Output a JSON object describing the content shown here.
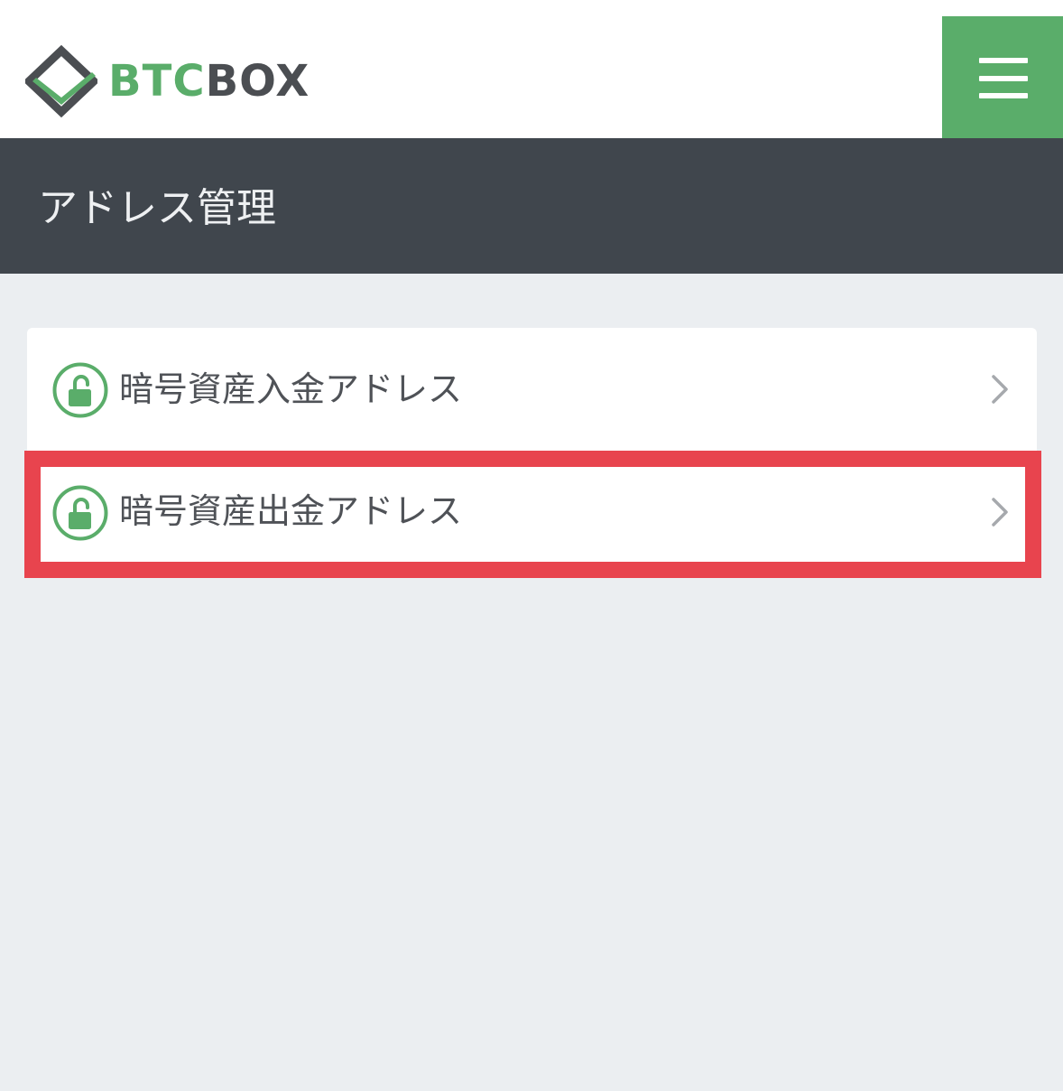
{
  "header": {
    "logo_text_btc": "BTC",
    "logo_text_box": "BOX",
    "logo_icon": "diamond-check-logo",
    "menu_icon": "hamburger-menu-icon"
  },
  "page": {
    "title": "アドレス管理"
  },
  "address_menu": {
    "items": [
      {
        "label": "暗号資産入金アドレス",
        "icon": "unlock-icon",
        "chevron": "chevron-right-icon"
      },
      {
        "label": "暗号資産出金アドレス",
        "icon": "unlock-icon",
        "chevron": "chevron-right-icon",
        "highlighted": true
      }
    ]
  },
  "colors": {
    "brand_green": "#5aad6a",
    "dark_gray": "#4b4e52",
    "title_bar": "#40464d",
    "background": "#ebeef1",
    "highlight_red": "#e8444e"
  }
}
